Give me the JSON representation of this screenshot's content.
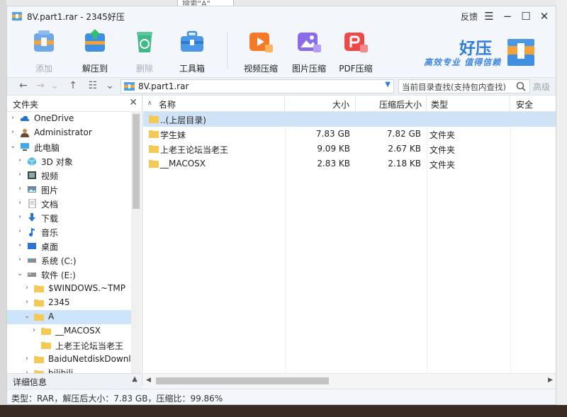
{
  "background": {
    "search_fragment": "搜索\"A\""
  },
  "window": {
    "title": "8V.part1.rar - 2345好压",
    "feedback": "反馈"
  },
  "toolbar": {
    "buttons": [
      {
        "label": "添加",
        "enabled": false,
        "icon": "add-archive-icon"
      },
      {
        "label": "解压到",
        "enabled": true,
        "icon": "extract-icon"
      },
      {
        "label": "删除",
        "enabled": false,
        "icon": "recycle-icon"
      },
      {
        "label": "工具箱",
        "enabled": true,
        "icon": "toolbox-icon"
      },
      {
        "label": "视频压缩",
        "enabled": true,
        "icon": "video-compress-icon"
      },
      {
        "label": "图片压缩",
        "enabled": true,
        "icon": "image-compress-icon"
      },
      {
        "label": "PDF压缩",
        "enabled": true,
        "icon": "pdf-compress-icon"
      }
    ],
    "brand_name": "好压",
    "brand_slogan": "高效专业 值得信赖"
  },
  "addressbar": {
    "path": "8V.part1.rar",
    "search_placeholder": "当前目录查找(支持包内查找)",
    "advanced": "高级"
  },
  "sidebar": {
    "header": "文件夹",
    "items": [
      {
        "label": "OneDrive",
        "icon": "cloud-icon"
      },
      {
        "label": "Administrator",
        "icon": "user-icon"
      },
      {
        "label": "此电脑",
        "icon": "computer-icon"
      },
      {
        "label": "3D 对象",
        "icon": "3d-objects-icon"
      },
      {
        "label": "视频",
        "icon": "video-folder-icon"
      },
      {
        "label": "图片",
        "icon": "pictures-folder-icon"
      },
      {
        "label": "文档",
        "icon": "documents-folder-icon"
      },
      {
        "label": "下载",
        "icon": "downloads-folder-icon"
      },
      {
        "label": "音乐",
        "icon": "music-folder-icon"
      },
      {
        "label": "桌面",
        "icon": "desktop-folder-icon"
      },
      {
        "label": "系统 (C:)",
        "icon": "drive-icon"
      },
      {
        "label": "软件 (E:)",
        "icon": "drive-icon"
      },
      {
        "label": "$WINDOWS.~TMP",
        "icon": "folder-icon"
      },
      {
        "label": "2345",
        "icon": "folder-icon"
      },
      {
        "label": "A",
        "icon": "folder-icon"
      },
      {
        "label": "__MACOSX",
        "icon": "folder-icon"
      },
      {
        "label": "上老王论坛当老王",
        "icon": "folder-icon"
      },
      {
        "label": "BaiduNetdiskDownl",
        "icon": "folder-icon"
      },
      {
        "label": "bilibili",
        "icon": "folder-icon"
      }
    ],
    "details_label": "详细信息"
  },
  "filelist": {
    "columns": [
      "名称",
      "大小",
      "压缩后大小",
      "类型",
      "安全"
    ],
    "rows": [
      {
        "name": "..(上层目录)",
        "size": "",
        "packed": "",
        "type": ""
      },
      {
        "name": "学生妹",
        "size": "7.83 GB",
        "packed": "7.82 GB",
        "type": "文件夹"
      },
      {
        "name": "上老王论坛当老王",
        "size": "9.09 KB",
        "packed": "2.67 KB",
        "type": "文件夹"
      },
      {
        "name": "__MACOSX",
        "size": "2.83 KB",
        "packed": "2.18 KB",
        "type": "文件夹"
      }
    ]
  },
  "status": {
    "text": "类型：RAR，解压后大小：7.83 GB，压缩比：99.86%"
  },
  "colors": {
    "accent": "#2f7be0",
    "selection": "#cde4fb",
    "folder": "#f5c955"
  }
}
